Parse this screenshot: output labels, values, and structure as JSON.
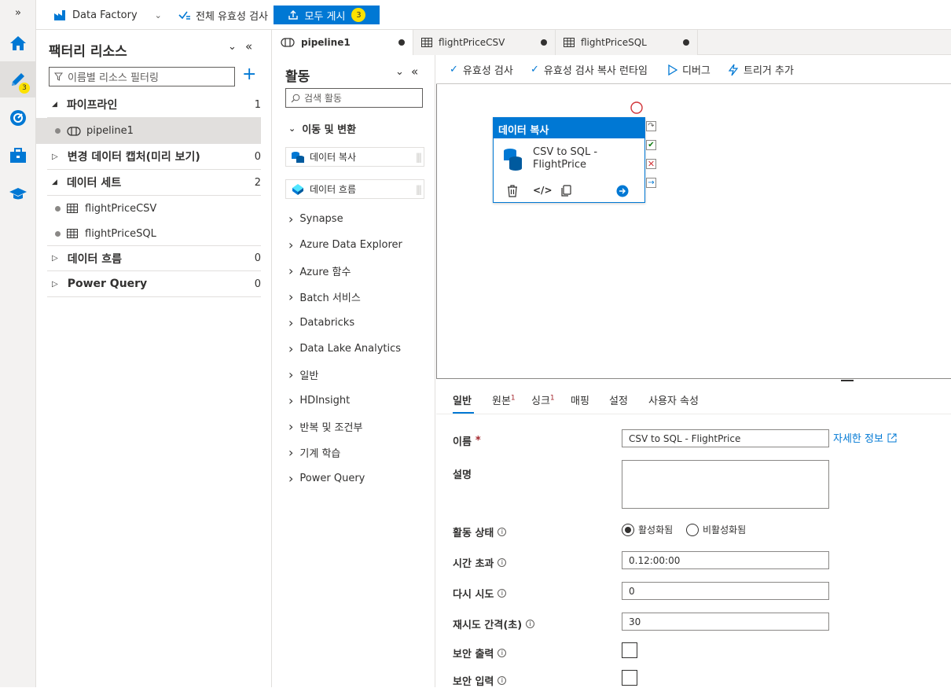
{
  "topbar": {
    "factory_label": "Data Factory",
    "validate_all_label": "전체 유효성 검사",
    "publish_label": "모두 게시",
    "publish_count": "3"
  },
  "rail": {
    "author_badge": "3"
  },
  "resources": {
    "title": "팩터리 리소스",
    "filter_placeholder": "이름별 리소스 필터링",
    "sections": [
      {
        "label": "파이프라인",
        "count": "1",
        "children": [
          "pipeline1"
        ]
      },
      {
        "label": "변경 데이터 캡처(미리 보기)",
        "count": "0"
      },
      {
        "label": "데이터 세트",
        "count": "2",
        "children": [
          "flightPriceCSV",
          "flightPriceSQL"
        ]
      },
      {
        "label": "데이터 흐름",
        "count": "0"
      },
      {
        "label": "Power Query",
        "count": "0"
      }
    ]
  },
  "tabs": [
    {
      "label": "pipeline1"
    },
    {
      "label": "flightPriceCSV"
    },
    {
      "label": "flightPriceSQL"
    }
  ],
  "activities": {
    "title": "활동",
    "search_placeholder": "검색 활동",
    "expanded_category": "이동 및 변환",
    "items": [
      "데이터 복사",
      "데이터 흐름"
    ],
    "categories": [
      "Synapse",
      "Azure Data Explorer",
      "Azure 함수",
      "Batch 서비스",
      "Databricks",
      "Data Lake Analytics",
      "일반",
      "HDInsight",
      "반복 및 조건부",
      "기계 학습",
      "Power Query"
    ]
  },
  "canvas_toolbar": {
    "validate": "유효성 검사",
    "validate_runtime": "유효성 검사 복사 런타임",
    "debug": "디버그",
    "add_trigger": "트리거 추가"
  },
  "node": {
    "header": "데이터 복사",
    "name_line1": "CSV to SQL -",
    "name_line2": "FlightPrice"
  },
  "props": {
    "tabs": [
      {
        "label": "일반",
        "sup": ""
      },
      {
        "label": "원본",
        "sup": "1"
      },
      {
        "label": "싱크",
        "sup": "1"
      },
      {
        "label": "매핑",
        "sup": ""
      },
      {
        "label": "설정",
        "sup": ""
      },
      {
        "label": "사용자 속성",
        "sup": ""
      }
    ],
    "name_label": "이름",
    "name_value": "CSV to SQL - FlightPrice",
    "learn_more": "자세한 정보",
    "description_label": "설명",
    "state_label": "활동 상태",
    "state_active": "활성화됨",
    "state_inactive": "비활성화됨",
    "timeout_label": "시간 초과",
    "timeout_value": "0.12:00:00",
    "retry_label": "다시 시도",
    "retry_value": "0",
    "retry_interval_label": "재시도 간격(초)",
    "retry_interval_value": "30",
    "secure_output_label": "보안 출력",
    "secure_input_label": "보안 입력"
  },
  "colors": {
    "accent": "#0078d4",
    "badge": "#fce100"
  }
}
